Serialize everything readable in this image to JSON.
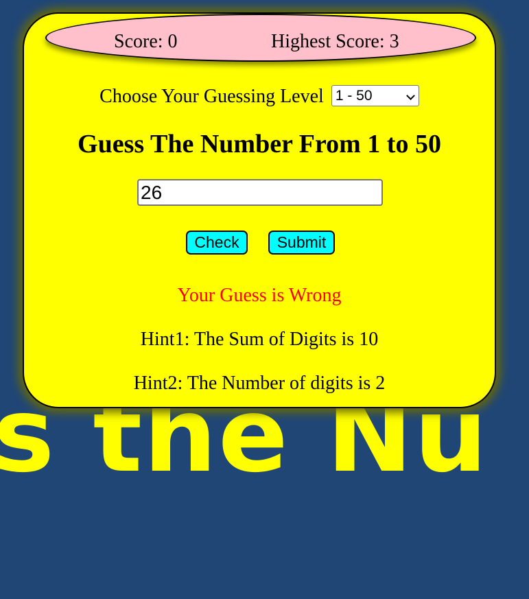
{
  "background_text": "s the Nu",
  "scoreboard": {
    "score": "Score: 0",
    "highest_score": "Highest Score: 3"
  },
  "level": {
    "label": "Choose Your Guessing Level",
    "selected": "1 - 50"
  },
  "heading": "Guess The Number From 1 to 50",
  "guess_input": {
    "value": "26"
  },
  "buttons": {
    "check": "Check",
    "submit": "Submit"
  },
  "result": "Your Guess is Wrong",
  "hints": {
    "hint1": "Hint1: The Sum of Digits is 10",
    "hint2": "Hint2: The Number of digits is 2"
  },
  "colors": {
    "page_background": "#204676",
    "card": "#ffff00",
    "score_pill": "#ffc0cb",
    "buttons": "#00ffff",
    "result_text": "#ff0000"
  }
}
